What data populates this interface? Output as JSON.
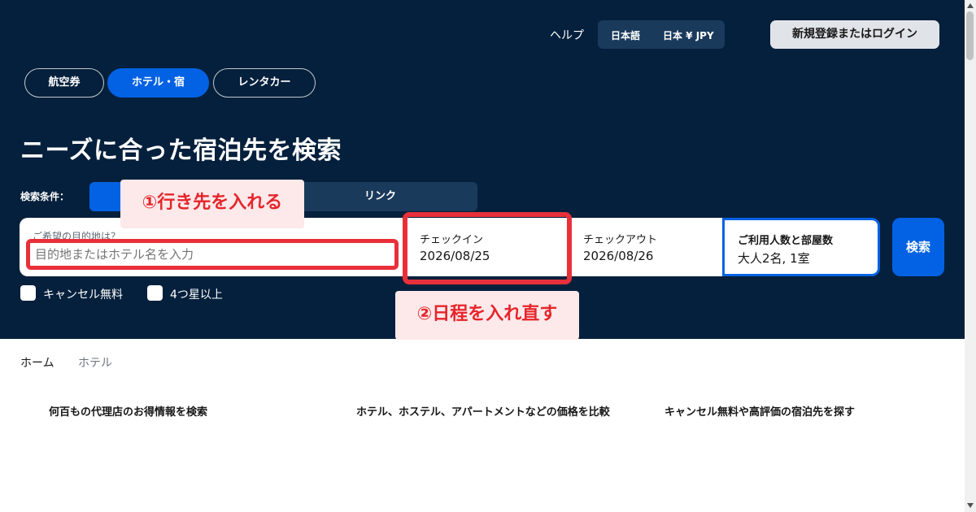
{
  "header": {
    "help": "ヘルプ",
    "language": "日本語",
    "region_currency": "日本  ¥ JPY",
    "login": "新規登録またはログイン"
  },
  "product_tabs": [
    {
      "label": "航空券",
      "active": false
    },
    {
      "label": "ホテル・宿",
      "active": true
    },
    {
      "label": "レンタカー",
      "active": false
    }
  ],
  "headline": "ニーズに合った宿泊先を検索",
  "search_conditions": {
    "label": "検索条件：",
    "link_option": "リンク"
  },
  "search": {
    "destination_label": "ご希望の目的地は？",
    "destination_placeholder": "目的地またはホテル名を入力",
    "checkin_label": "チェックイン",
    "checkin_value": "2026/08/25",
    "checkout_label": "チェックアウト",
    "checkout_value": "2026/08/26",
    "guests_label": "ご利用人数と部屋数",
    "guests_value": "大人2名, 1室",
    "search_button": "検索"
  },
  "filters": [
    {
      "label": "キャンセル無料",
      "checked": false
    },
    {
      "label": "4つ星以上",
      "checked": false
    }
  ],
  "annotations": {
    "step1": "①行き先を入れる",
    "step2": "②日程を入れ直す"
  },
  "breadcrumb": [
    "ホーム",
    "ホテル"
  ],
  "features": [
    "何百もの代理店のお得情報を検索",
    "ホテル、ホステル、アパートメントなどの価格を比較",
    "キャンセル無料や高評価の宿泊先を探す"
  ],
  "colors": {
    "hero_bg": "#05203c",
    "accent": "#0362e3",
    "annotation_red": "#e8303a",
    "annotation_bg": "#fde9ea"
  }
}
